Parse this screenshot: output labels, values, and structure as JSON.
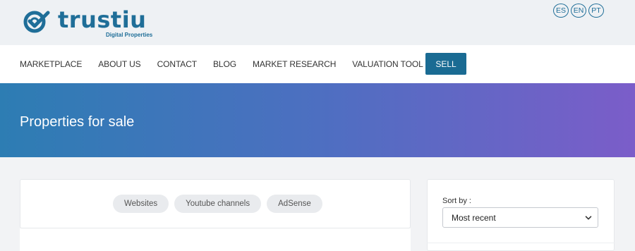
{
  "brand": {
    "name": "trustiu",
    "tagline": "Digital Properties",
    "color": "#1f6e98"
  },
  "languages": [
    "ES",
    "EN",
    "PT"
  ],
  "nav": {
    "items": [
      "MARKETPLACE",
      "ABOUT US",
      "CONTACT",
      "BLOG",
      "MARKET RESEARCH",
      "VALUATION TOOL"
    ],
    "sell_label": "SELL"
  },
  "hero": {
    "title": "Properties for sale"
  },
  "filters": {
    "chips": [
      "Websites",
      "Youtube channels",
      "AdSense"
    ]
  },
  "sort": {
    "label": "Sort by :",
    "value": "Most recent"
  },
  "colors": {
    "hero_start": "#2d7db3",
    "hero_end": "#7b5dc9",
    "button": "#1a6b93"
  }
}
